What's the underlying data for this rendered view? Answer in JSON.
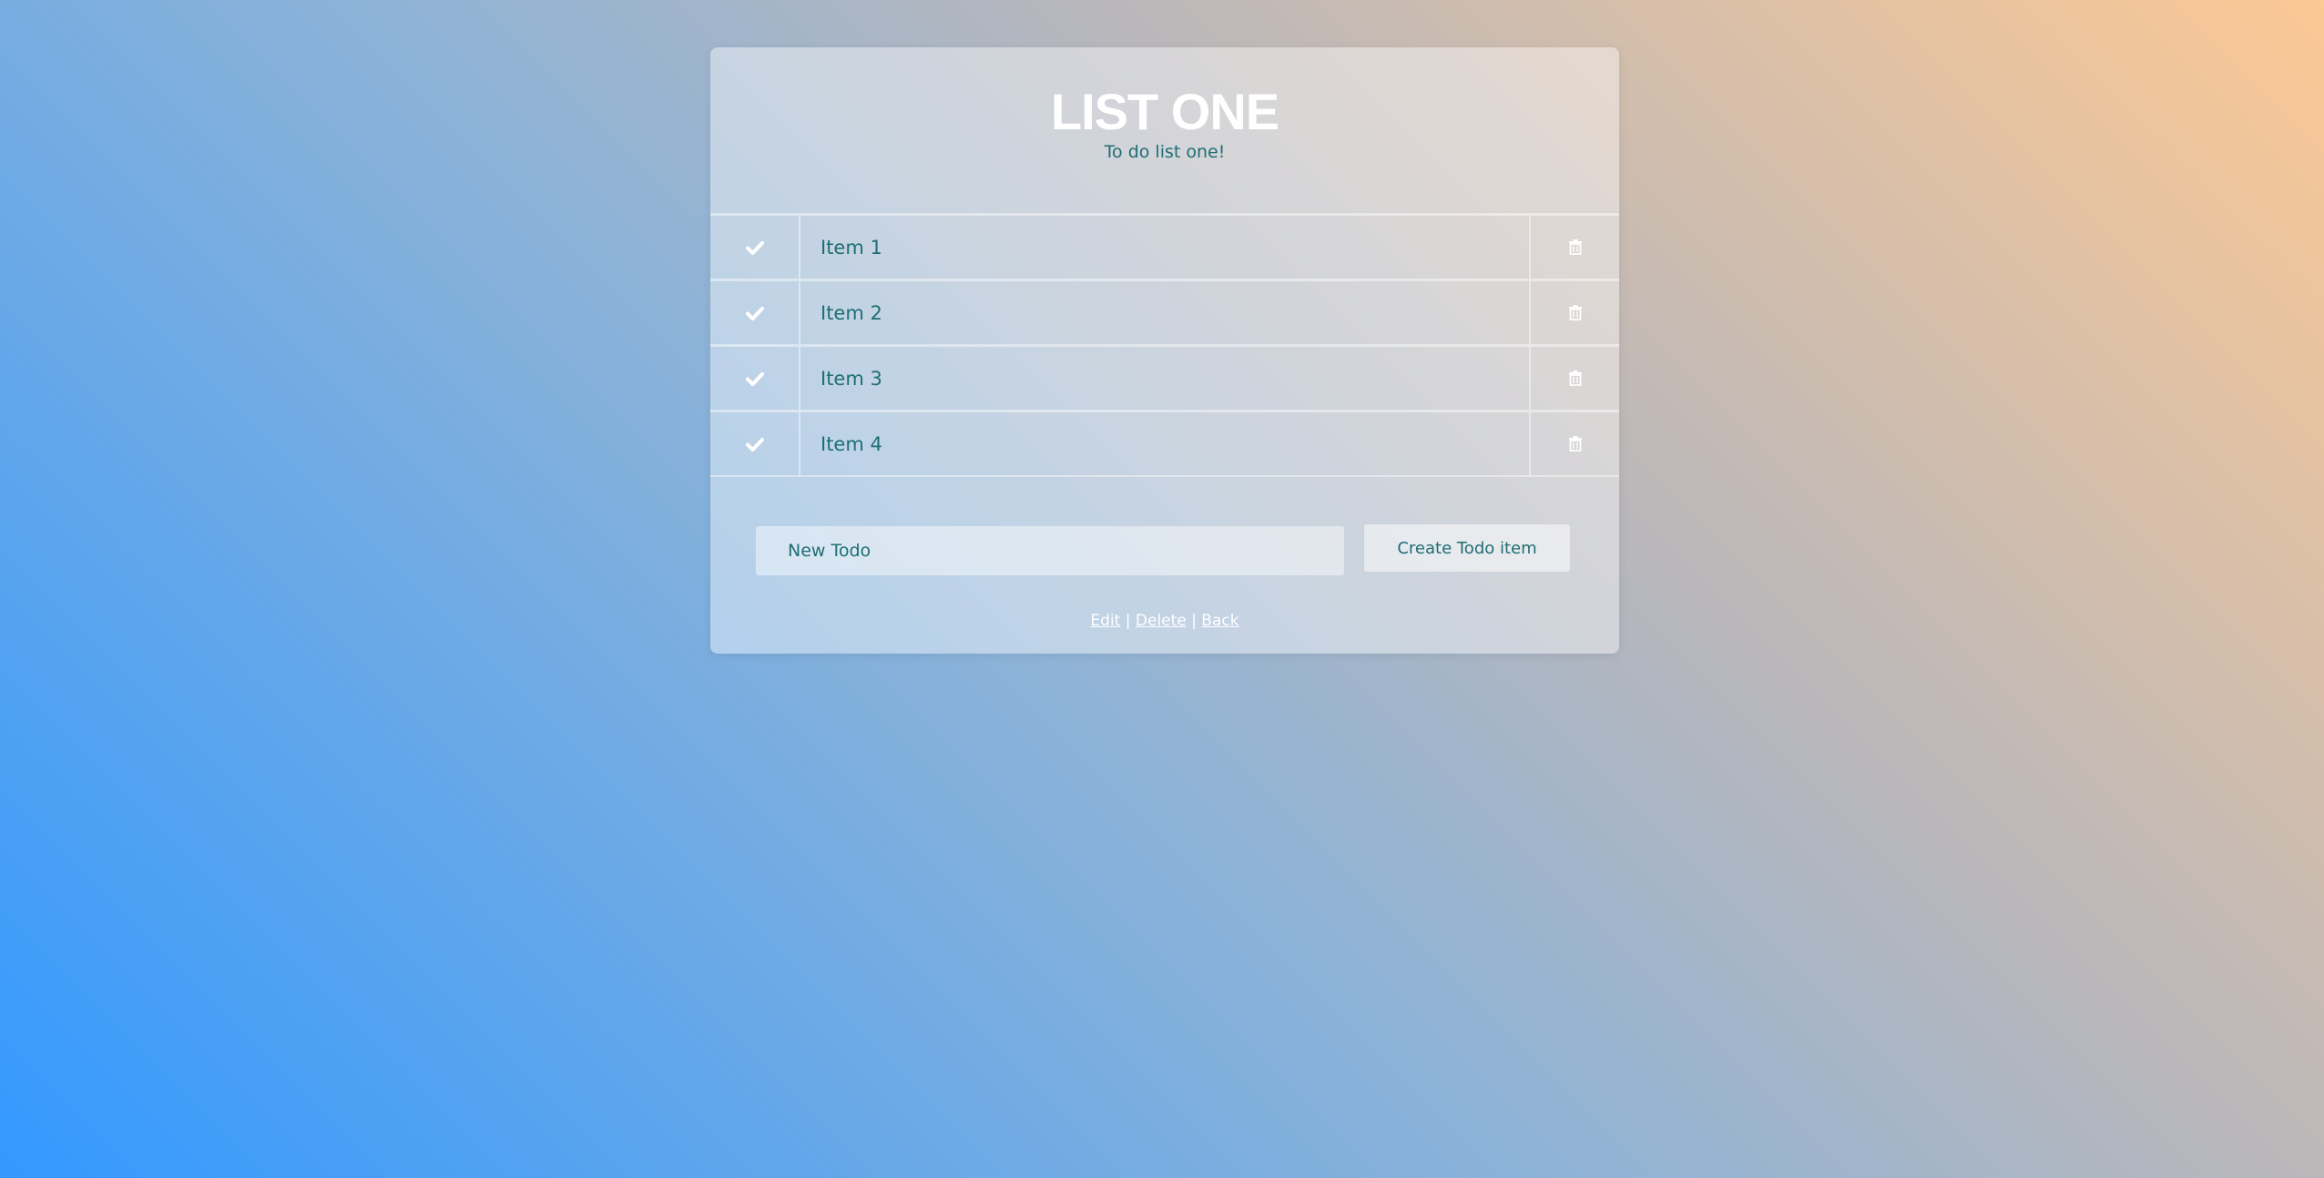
{
  "list": {
    "title": "LIST ONE",
    "description": "To do list one!"
  },
  "items": [
    {
      "label": "Item 1",
      "check_icon": "check-icon",
      "delete_icon": "trash-icon"
    },
    {
      "label": "Item 2",
      "check_icon": "check-icon",
      "delete_icon": "trash-icon"
    },
    {
      "label": "Item 3",
      "check_icon": "check-icon",
      "delete_icon": "trash-icon"
    },
    {
      "label": "Item 4",
      "check_icon": "check-icon",
      "delete_icon": "trash-icon"
    }
  ],
  "form": {
    "input_placeholder": "New Todo",
    "input_value": "",
    "submit_label": "Create Todo item"
  },
  "footer": {
    "edit_label": "Edit",
    "delete_label": "Delete",
    "back_label": "Back",
    "separator": "|"
  },
  "colors": {
    "text_teal": "#1e6e74",
    "title_white": "#ffffff",
    "gradient_start": "#3399ff",
    "gradient_end": "#fcc894"
  }
}
